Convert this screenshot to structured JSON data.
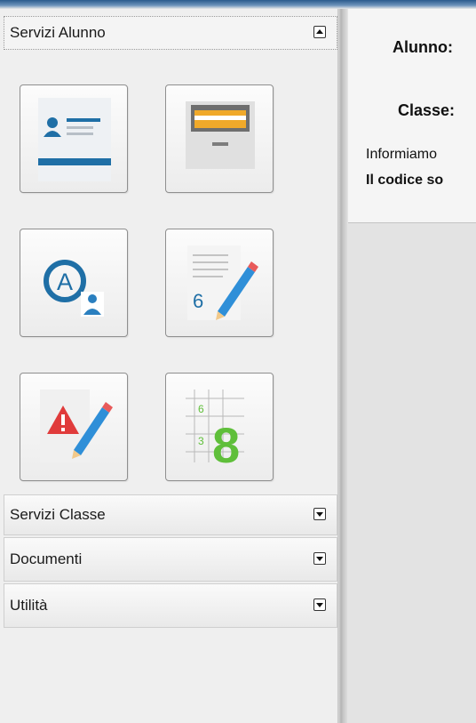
{
  "sidebar": {
    "sections": [
      {
        "label": "Servizi Alunno",
        "expanded": true
      },
      {
        "label": "Servizi Classe",
        "expanded": false
      },
      {
        "label": "Documenti",
        "expanded": false
      },
      {
        "label": "Utilità",
        "expanded": false
      }
    ],
    "tiles": [
      {
        "icon": "student-card-icon"
      },
      {
        "icon": "file-drawer-icon"
      },
      {
        "icon": "absences-icon"
      },
      {
        "icon": "grades-notebook-icon"
      },
      {
        "icon": "disciplinary-notes-icon"
      },
      {
        "icon": "grade-grid-icon"
      }
    ]
  },
  "info": {
    "student_label": "Alunno:",
    "class_label": "Classe:",
    "notice_text": "Informiamo",
    "code_text": "Il codice so"
  },
  "colors": {
    "accent_blue": "#1f6fa6",
    "warning_red": "#e03b3b",
    "grade_green": "#5fbf3a"
  }
}
